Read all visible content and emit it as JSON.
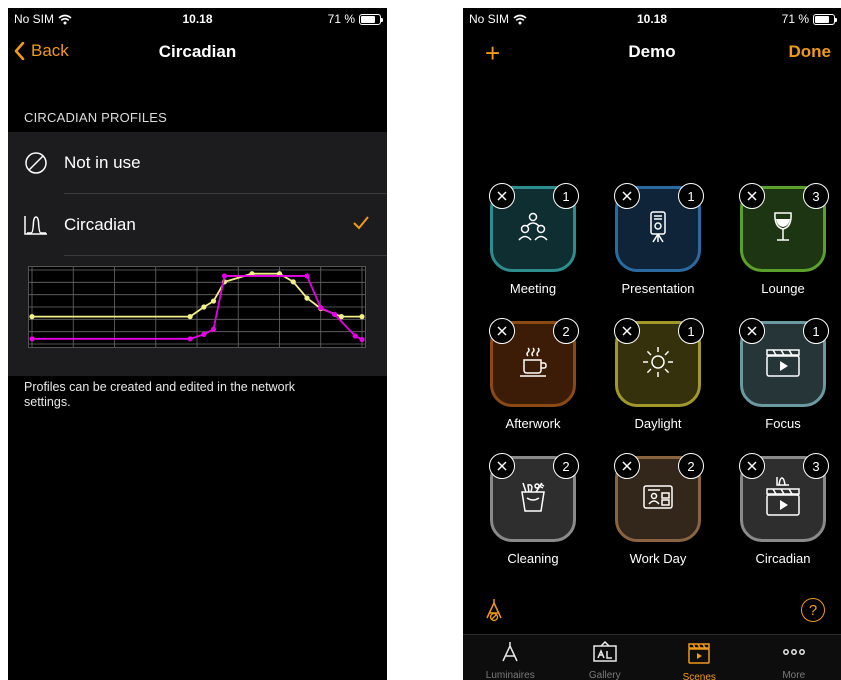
{
  "left_screen": {
    "status": {
      "carrier": "No SIM",
      "time": "10.18",
      "battery": "71 %"
    },
    "nav": {
      "back": "Back",
      "title": "Circadian"
    },
    "section_header": "CIRCADIAN PROFILES",
    "rows": [
      {
        "label": "Not in use",
        "icon": "prohibited-icon",
        "selected": false
      },
      {
        "label": "Circadian",
        "icon": "circadian-curve-icon",
        "selected": true
      }
    ],
    "footer_note": "Profiles can be created and edited in the network settings.",
    "colors": {
      "accent": "#f09a1a",
      "yellow_curve": "#f3f08a",
      "magenta_curve": "#e600e6"
    },
    "chart_data": {
      "type": "line",
      "x": [
        0,
        1,
        2,
        3,
        4,
        5,
        6,
        7,
        8,
        9,
        10,
        11,
        12,
        13,
        14,
        15,
        16,
        17,
        18,
        19,
        20,
        21,
        22,
        23,
        24
      ],
      "xlim": [
        0,
        24
      ],
      "ylim": [
        0,
        1
      ],
      "grid": true,
      "series": [
        {
          "color": "#f3f08a",
          "points": [
            [
              0,
              0.37
            ],
            [
              11.5,
              0.37
            ],
            [
              12.5,
              0.5
            ],
            [
              13.2,
              0.58
            ],
            [
              14,
              0.84
            ],
            [
              16,
              0.95
            ],
            [
              18,
              0.95
            ],
            [
              19,
              0.84
            ],
            [
              20,
              0.62
            ],
            [
              21,
              0.48
            ],
            [
              22.5,
              0.37
            ],
            [
              24,
              0.37
            ]
          ]
        },
        {
          "color": "#e600e6",
          "points": [
            [
              0,
              0.07
            ],
            [
              11.5,
              0.07
            ],
            [
              12.5,
              0.13
            ],
            [
              13.2,
              0.2
            ],
            [
              14,
              0.92
            ],
            [
              20,
              0.92
            ],
            [
              21,
              0.49
            ],
            [
              22,
              0.4
            ],
            [
              23.5,
              0.11
            ],
            [
              24,
              0.06
            ]
          ]
        }
      ]
    }
  },
  "right_screen": {
    "status": {
      "carrier": "No SIM",
      "time": "10.18",
      "battery": "71 %"
    },
    "nav": {
      "add": "+",
      "title": "Demo",
      "done": "Done"
    },
    "scenes": [
      {
        "label": "Meeting",
        "count": "1",
        "border": "#2d8c8c",
        "fill": "#0f2e31",
        "icon": "meeting-people-icon"
      },
      {
        "label": "Presentation",
        "count": "1",
        "border": "#2a6aa0",
        "fill": "#0f2438",
        "icon": "presentation-board-icon"
      },
      {
        "label": "Lounge",
        "count": "3",
        "border": "#5aa02a",
        "fill": "#1d3512",
        "icon": "wine-glass-icon"
      },
      {
        "label": "Afterwork",
        "count": "2",
        "border": "#8a4a14",
        "fill": "#3c1c06",
        "icon": "coffee-cup-icon"
      },
      {
        "label": "Daylight",
        "count": "1",
        "border": "#a0982a",
        "fill": "#34310c",
        "icon": "sun-icon"
      },
      {
        "label": "Focus",
        "count": "1",
        "border": "#6a9aa0",
        "fill": "#253538",
        "icon": "clapperboard-icon"
      },
      {
        "label": "Cleaning",
        "count": "2",
        "border": "#8a8a8a",
        "fill": "#2e2e2e",
        "icon": "cleaning-bucket-icon"
      },
      {
        "label": "Work Day",
        "count": "2",
        "border": "#8a6440",
        "fill": "#33261a",
        "icon": "id-card-icon"
      },
      {
        "label": "Circadian",
        "count": "3",
        "border": "#8a8a8a",
        "fill": "#2e2e2e",
        "icon": "circadian-clapperboard-icon"
      }
    ],
    "tabs": [
      {
        "label": "Luminaires",
        "icon": "luminaire-icon",
        "active": false
      },
      {
        "label": "Gallery",
        "icon": "gallery-icon",
        "active": false
      },
      {
        "label": "Scenes",
        "icon": "scenes-icon",
        "active": true
      },
      {
        "label": "More",
        "icon": "more-icon",
        "active": false
      }
    ],
    "tools": {
      "help": "?"
    }
  }
}
